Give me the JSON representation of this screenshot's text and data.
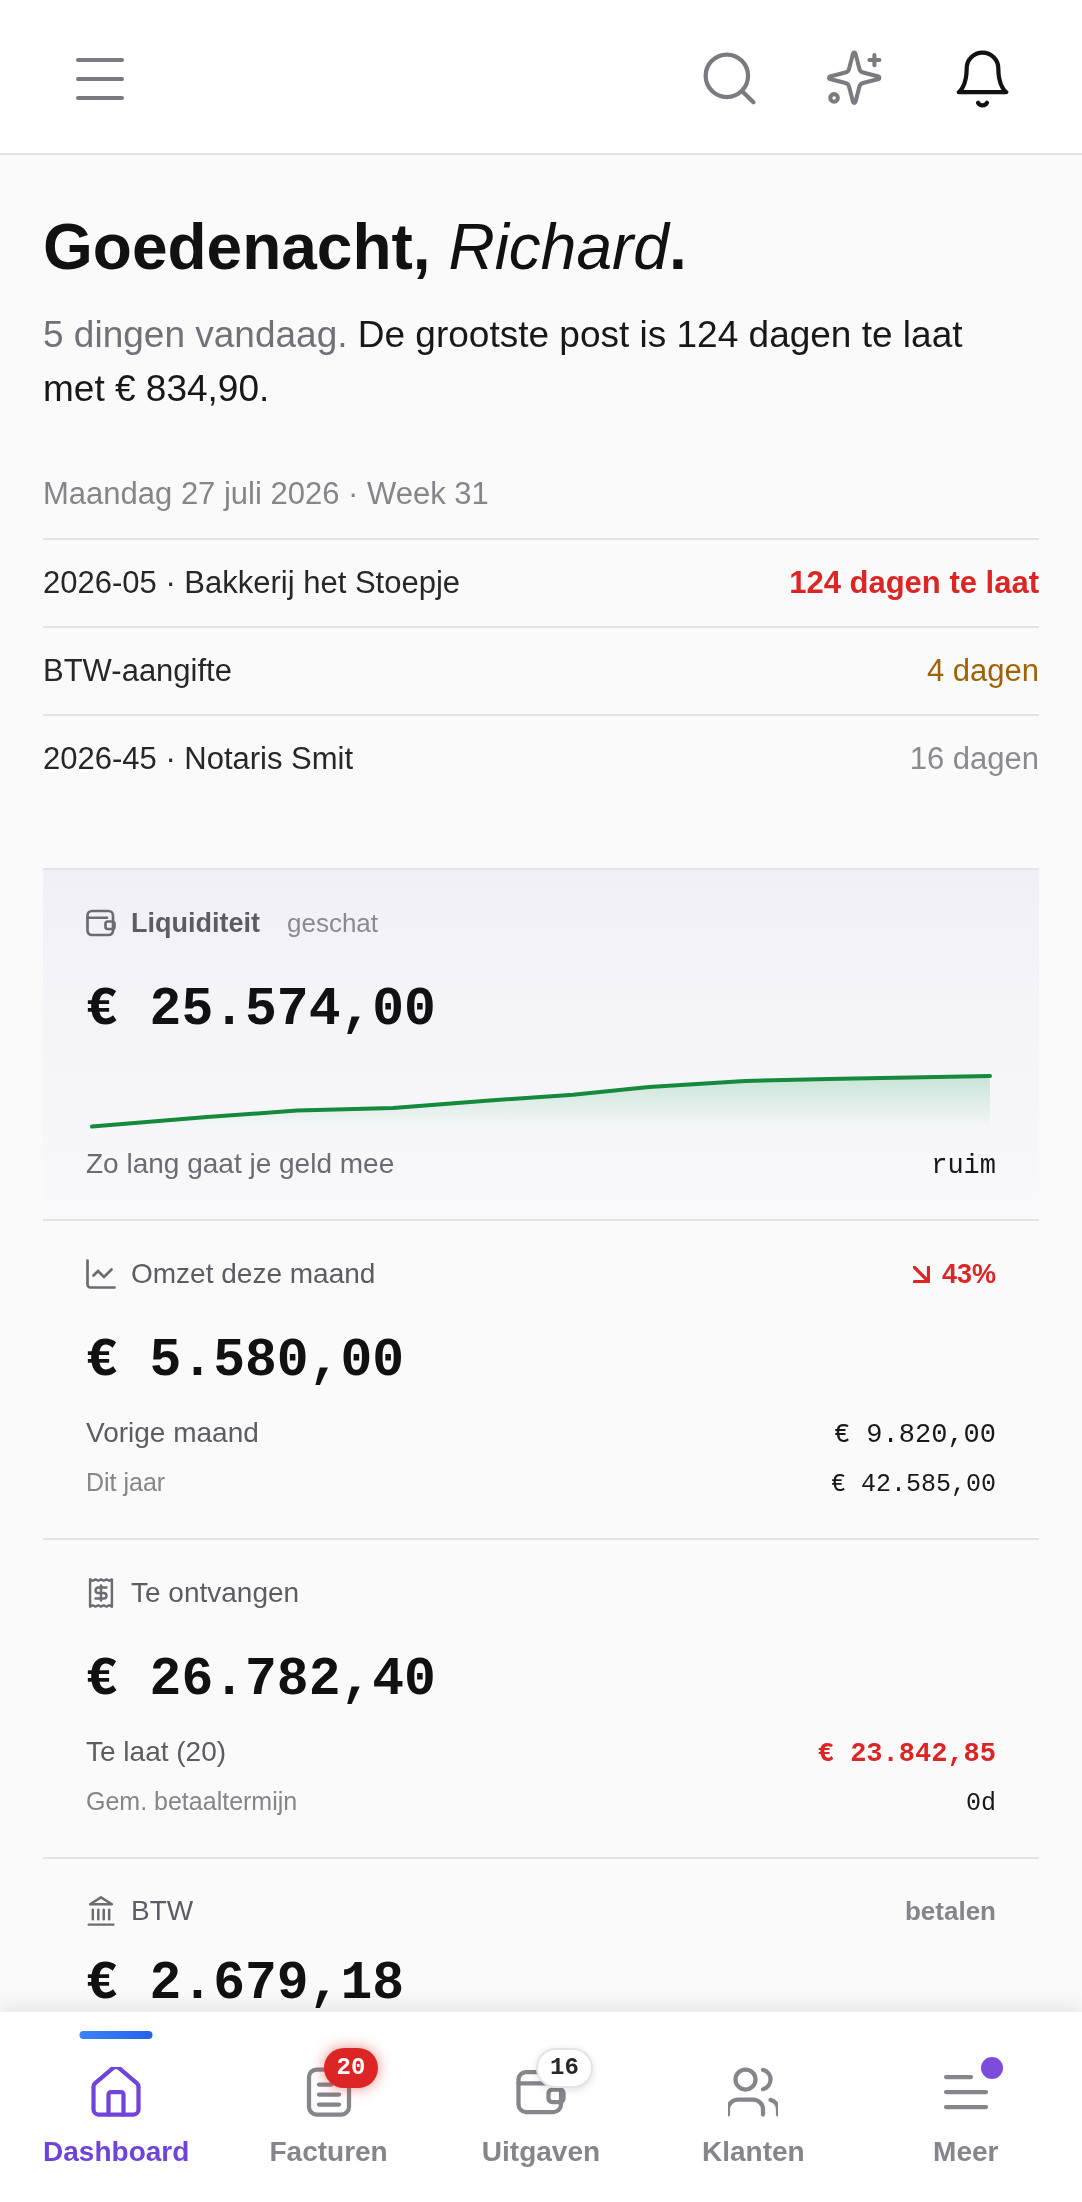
{
  "greeting": {
    "title": "Goedenacht, *Richard*.",
    "summary": "5 dingen vandaag. **De grootste post is 124 dagen te laat met € 834,90.**",
    "date": "Maandag 27 juli 2026 · Week 31"
  },
  "agenda": [
    {
      "title": "2026-05 · Bakkerij het Stoepje",
      "due": "124 dagen te laat",
      "kind": "overdue"
    },
    {
      "title": "BTW-aangifte",
      "due": "4 dagen",
      "kind": "soon"
    },
    {
      "title": "2026-45 · Notaris Smit",
      "due": "16 dagen",
      "kind": "later"
    }
  ],
  "cards": [
    {
      "kind": "liquidity",
      "label": "Liquiditeit",
      "note": "geschat",
      "amount": "€ 25.574,00",
      "footer": {
        "label": "Zo lang gaat je geld mee",
        "value": "ruim"
      }
    },
    {
      "kind": "revenue",
      "label": "Omzet deze maand",
      "trend": {
        "kind": "down",
        "text": "43%"
      },
      "amount": "€ 5.580,00",
      "rows": [
        {
          "kind": "primary",
          "label": "Vorige maand",
          "value": "€ 9.820,00"
        },
        {
          "kind": "secondary",
          "label": "Dit jaar",
          "value": "€ 42.585,00"
        }
      ]
    },
    {
      "kind": "receivables",
      "label": "Te ontvangen",
      "amount": "€ 26.782,40",
      "rows": [
        {
          "kind": "overdue",
          "label": "Te laat (20)",
          "value": "€ 23.842,85"
        },
        {
          "kind": "secondary",
          "label": "Gem. betaaltermijn",
          "value": "0d"
        }
      ]
    },
    {
      "kind": "vat",
      "label": "BTW",
      "status": "betalen",
      "amount": "€ 2.679,18"
    }
  ],
  "nav": [
    {
      "kind": "home",
      "label": "Dashboard",
      "selected": true,
      "dot": false
    },
    {
      "kind": "invoices",
      "label": "Facturen",
      "selected": false,
      "dot": false,
      "badge": {
        "kind": "alert",
        "text": "20"
      }
    },
    {
      "kind": "expenses",
      "label": "Uitgaven",
      "selected": false,
      "dot": false,
      "badge": {
        "kind": "count",
        "text": "16"
      }
    },
    {
      "kind": "clients",
      "label": "Klanten",
      "selected": false,
      "dot": false
    },
    {
      "kind": "more",
      "label": "Meer",
      "selected": false,
      "dot": true
    }
  ]
}
